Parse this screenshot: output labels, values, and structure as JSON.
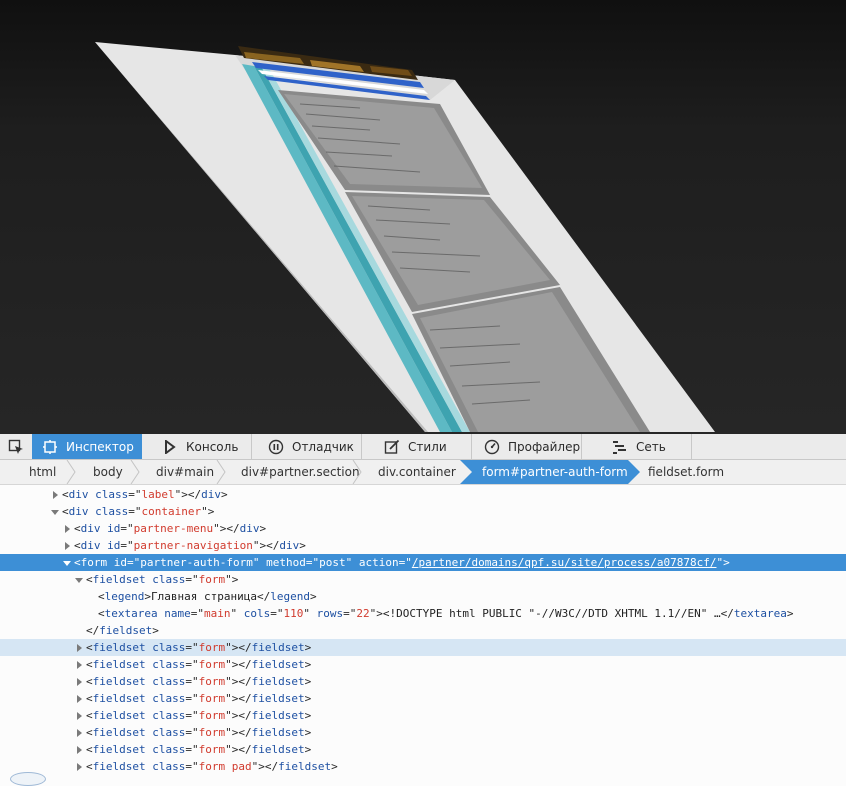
{
  "view3d": {
    "label": "3D view"
  },
  "toolbar": {
    "picker_icon": "element-picker-icon",
    "tabs": [
      {
        "label": "Инспектор",
        "icon": "inspector-icon",
        "active": true
      },
      {
        "label": "Консоль",
        "icon": "console-icon"
      },
      {
        "label": "Отладчик",
        "icon": "debugger-icon"
      },
      {
        "label": "Стили",
        "icon": "style-editor-icon"
      },
      {
        "label": "Профайлер",
        "icon": "profiler-icon"
      },
      {
        "label": "Сеть",
        "icon": "network-icon"
      }
    ]
  },
  "breadcrumbs": [
    "html",
    "body",
    "div#main",
    "div#partner.section",
    "div.container",
    "form#partner-auth-form",
    "fieldset.form"
  ],
  "breadcrumbs_selected": 5,
  "tree": {
    "r_label": {
      "tag": "div",
      "attr": "class",
      "value": "label"
    },
    "r_container": {
      "tag": "div",
      "attr": "class",
      "value": "container"
    },
    "r_menu": {
      "tag": "div",
      "attr": "id",
      "value": "partner-menu"
    },
    "r_nav": {
      "tag": "div",
      "attr": "id",
      "value": "partner-navigation"
    },
    "r_form": {
      "tag": "form",
      "id_attr": "id",
      "id_value": "partner-auth-form",
      "method_attr": "method",
      "method_value": "post",
      "action_attr": "action",
      "action_value": "/partner/domains/qpf.su/site/process/a07878cf/"
    },
    "r_fieldset_open": {
      "tag": "fieldset",
      "attr": "class",
      "value": "form"
    },
    "r_legend": {
      "tag": "legend",
      "text": "Главная страница"
    },
    "r_textarea": {
      "tag": "textarea",
      "name_attr": "name",
      "name_value": "main",
      "cols_attr": "cols",
      "cols_value": "110",
      "rows_attr": "rows",
      "rows_value": "22",
      "text": "<!DOCTYPE html PUBLIC \"-//W3C//DTD XHTML 1.1//EN\" …"
    },
    "r_fieldset_close": {
      "tag": "fieldset"
    },
    "fieldsets": [
      {
        "tag": "fieldset",
        "attr": "class",
        "value": "form"
      },
      {
        "tag": "fieldset",
        "attr": "class",
        "value": "form"
      },
      {
        "tag": "fieldset",
        "attr": "class",
        "value": "form"
      },
      {
        "tag": "fieldset",
        "attr": "class",
        "value": "form"
      },
      {
        "tag": "fieldset",
        "attr": "class",
        "value": "form"
      },
      {
        "tag": "fieldset",
        "attr": "class",
        "value": "form"
      },
      {
        "tag": "fieldset",
        "attr": "class",
        "value": "form"
      },
      {
        "tag": "fieldset",
        "attr": "class",
        "value": "form pad"
      }
    ]
  },
  "colors": {
    "accent": "#3d8fd6",
    "hover": "#d6e6f4",
    "tag_name": "#1e50a2",
    "attr_value": "#d13b2e"
  }
}
